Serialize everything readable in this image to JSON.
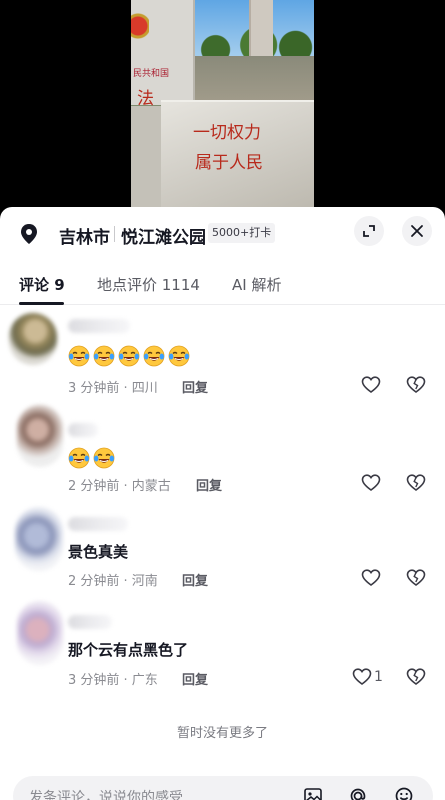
{
  "video": {
    "sign_small": "民共和国",
    "sign_fa": "法",
    "stone_line1": "一切权力",
    "stone_line2": "属于人民"
  },
  "location": {
    "city": "吉林市",
    "name": "悦江滩公园",
    "checkin_badge": "5000+打卡"
  },
  "tabs": [
    {
      "label": "评论 9",
      "active": true
    },
    {
      "label": "地点评价 1114",
      "active": false
    },
    {
      "label": "AI 解析",
      "active": false
    }
  ],
  "comments": [
    {
      "text": "",
      "emoji_count": 5,
      "emoji": "crying-laughing-emoji",
      "meta": "3 分钟前 · 四川",
      "reply": "回复",
      "likes": ""
    },
    {
      "text": "",
      "emoji_count": 2,
      "emoji": "crying-laughing-emoji",
      "meta": "2 分钟前 · 内蒙古",
      "reply": "回复",
      "likes": ""
    },
    {
      "text": "景色真美",
      "emoji_count": 0,
      "meta": "2 分钟前 · 河南",
      "reply": "回复",
      "likes": ""
    },
    {
      "text": "那个云有点黑色了",
      "emoji_count": 0,
      "meta": "3 分钟前 · 广东",
      "reply": "回复",
      "likes": "1"
    }
  ],
  "footer": {
    "no_more": "暂时没有更多了",
    "input_placeholder": "发条评论，说说你的感受"
  },
  "colors": {
    "sheet_bg": "#ffffff",
    "primary_text": "#161823",
    "secondary_text": "#8a8b91",
    "emoji_yellow": "#ffc83d",
    "emoji_tear": "#3aa0ff"
  }
}
